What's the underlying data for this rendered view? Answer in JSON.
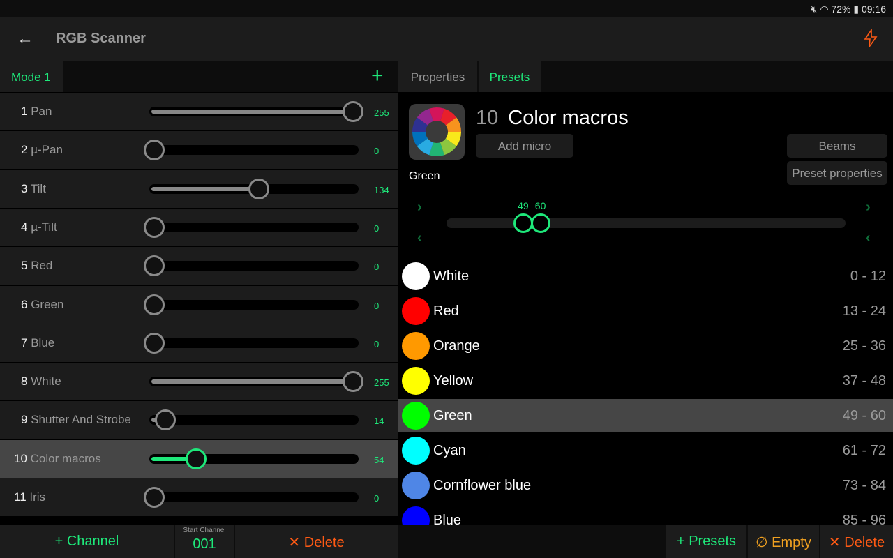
{
  "status": {
    "battery": "72%",
    "time": "09:16",
    "icons": [
      "mute-icon",
      "wifi-icon",
      "battery-icon"
    ]
  },
  "header": {
    "title": "RGB Scanner",
    "back_icon": "arrow-left-icon",
    "action_icon": "lightning-icon"
  },
  "modes": {
    "active": "Mode 1",
    "add_icon": "plus-icon"
  },
  "channels": [
    {
      "num": "1",
      "label": "Pan",
      "value": 255
    },
    {
      "num": "2",
      "label": "µ-Pan",
      "value": 0
    },
    {
      "num": "3",
      "label": "Tilt",
      "value": 134
    },
    {
      "num": "4",
      "label": "µ-Tilt",
      "value": 0
    },
    {
      "num": "5",
      "label": "Red",
      "value": 0
    },
    {
      "num": "6",
      "label": "Green",
      "value": 0
    },
    {
      "num": "7",
      "label": "Blue",
      "value": 0
    },
    {
      "num": "8",
      "label": "White",
      "value": 255
    },
    {
      "num": "9",
      "label": "Shutter And Strobe",
      "value": 14
    },
    {
      "num": "10",
      "label": "Color macros",
      "value": 54,
      "selected": true
    },
    {
      "num": "11",
      "label": "Iris",
      "value": 0
    }
  ],
  "tabs": [
    {
      "label": "Properties"
    },
    {
      "label": "Presets",
      "active": true
    }
  ],
  "preset": {
    "channel_num": "10",
    "channel_name": "Color macros",
    "add_micro": "Add micro",
    "beams": "Beams",
    "preset_properties": "Preset properties",
    "selected_name": "Green",
    "range_min": 49,
    "range_max": 60,
    "range_scale": [
      0,
      255
    ]
  },
  "presets": [
    {
      "name": "White",
      "range": "0 - 12",
      "color": "#ffffff"
    },
    {
      "name": "Red",
      "range": "13 - 24",
      "color": "#ff0000"
    },
    {
      "name": "Orange",
      "range": "25 - 36",
      "color": "#ff9900"
    },
    {
      "name": "Yellow",
      "range": "37 - 48",
      "color": "#ffff00"
    },
    {
      "name": "Green",
      "range": "49 - 60",
      "color": "#00ff00",
      "selected": true
    },
    {
      "name": "Cyan",
      "range": "61 - 72",
      "color": "#00ffff"
    },
    {
      "name": "Cornflower blue",
      "range": "73 - 84",
      "color": "#4f86e6"
    },
    {
      "name": "Blue",
      "range": "85 - 96",
      "color": "#0000ff"
    }
  ],
  "bottom": {
    "add_channel": "Channel",
    "start_channel_label": "Start Channel",
    "start_channel": "001",
    "delete": "Delete",
    "add_presets": "Presets",
    "empty": "Empty",
    "delete_presets": "Delete"
  },
  "colors": {
    "accent": "#1ee87a",
    "danger": "#ff5a14",
    "warning": "#f0a020"
  }
}
